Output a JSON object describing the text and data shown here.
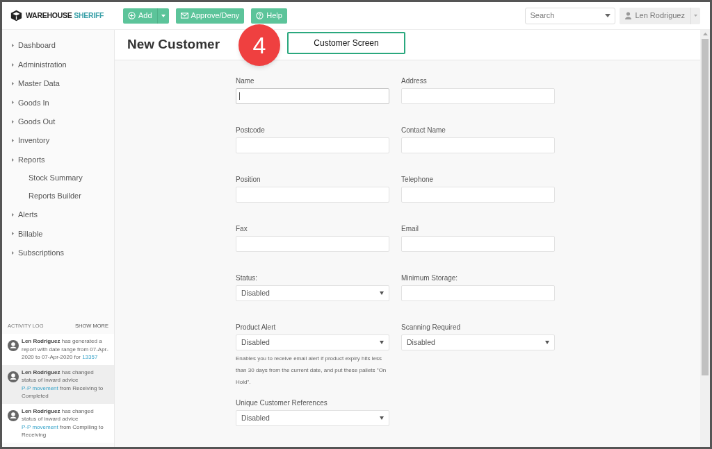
{
  "brand": {
    "word1": "WAREHOUSE",
    "word2": "SHERIFF"
  },
  "toolbar": [
    {
      "label": "Add",
      "dropdown": true
    },
    {
      "label": "Approve/Deny",
      "dropdown": false
    },
    {
      "label": "Help",
      "dropdown": false
    }
  ],
  "search": {
    "placeholder": "Search"
  },
  "user": {
    "name": "Len Rodriguez"
  },
  "page_title": "New Customer",
  "callout": {
    "number": "4",
    "label": "Customer Screen"
  },
  "sidebar": {
    "items": [
      {
        "label": "Dashboard"
      },
      {
        "label": "Administration"
      },
      {
        "label": "Master Data"
      },
      {
        "label": "Goods In"
      },
      {
        "label": "Goods Out"
      },
      {
        "label": "Inventory"
      },
      {
        "label": "Reports",
        "children": [
          {
            "label": "Stock Summary"
          },
          {
            "label": "Reports Builder"
          }
        ]
      },
      {
        "label": "Alerts"
      },
      {
        "label": "Billable"
      },
      {
        "label": "Subscriptions"
      }
    ]
  },
  "activity_log": {
    "title": "ACTIVITY LOG",
    "show_more": "SHOW MORE",
    "entries": [
      {
        "highlighted": false,
        "parts": [
          {
            "kind": "name",
            "text": "Len Rodriguez"
          },
          {
            "kind": "plain",
            "text": " has generated a report with date range from 07-Apr-2020 to 07-Apr-2020 for "
          },
          {
            "kind": "link",
            "text": "13357"
          }
        ]
      },
      {
        "highlighted": true,
        "parts": [
          {
            "kind": "name",
            "text": "Len Rodriguez"
          },
          {
            "kind": "plain",
            "text": " has changed status of inward advice "
          },
          {
            "kind": "link",
            "text": "P-P movement"
          },
          {
            "kind": "plain",
            "text": " from Receiving to Completed"
          }
        ]
      },
      {
        "highlighted": false,
        "parts": [
          {
            "kind": "name",
            "text": "Len Rodriguez"
          },
          {
            "kind": "plain",
            "text": " has changed status of inward advice "
          },
          {
            "kind": "link",
            "text": "P-P movement"
          },
          {
            "kind": "plain",
            "text": " from Compiling to Receiving"
          }
        ]
      }
    ]
  },
  "form": {
    "rows": [
      [
        {
          "label": "Name",
          "kind": "text",
          "focused": true
        },
        {
          "label": "Address",
          "kind": "text",
          "focused": false
        }
      ],
      [
        {
          "label": "Postcode",
          "kind": "text",
          "focused": false
        },
        {
          "label": "Contact Name",
          "kind": "text",
          "focused": false
        }
      ],
      [
        {
          "label": "Position",
          "kind": "text",
          "focused": false
        },
        {
          "label": "Telephone",
          "kind": "text",
          "focused": false
        }
      ],
      [
        {
          "label": "Fax",
          "kind": "text",
          "focused": false
        },
        {
          "label": "Email",
          "kind": "text",
          "focused": false
        }
      ],
      [
        {
          "label": "Status:",
          "kind": "select",
          "value": "Disabled"
        },
        {
          "label": "Minimum Storage:",
          "kind": "text",
          "focused": false
        }
      ],
      [
        {
          "label": "Product Alert",
          "kind": "select",
          "value": "Disabled",
          "help": "Enables you to receive email alert if product expiry hits less than 30 days from the current date, and put these pallets \"On Hold\"."
        },
        {
          "label": "Scanning Required",
          "kind": "select",
          "value": "Disabled"
        }
      ],
      [
        {
          "label": "Unique Customer References",
          "kind": "select",
          "value": "Disabled"
        }
      ]
    ]
  }
}
